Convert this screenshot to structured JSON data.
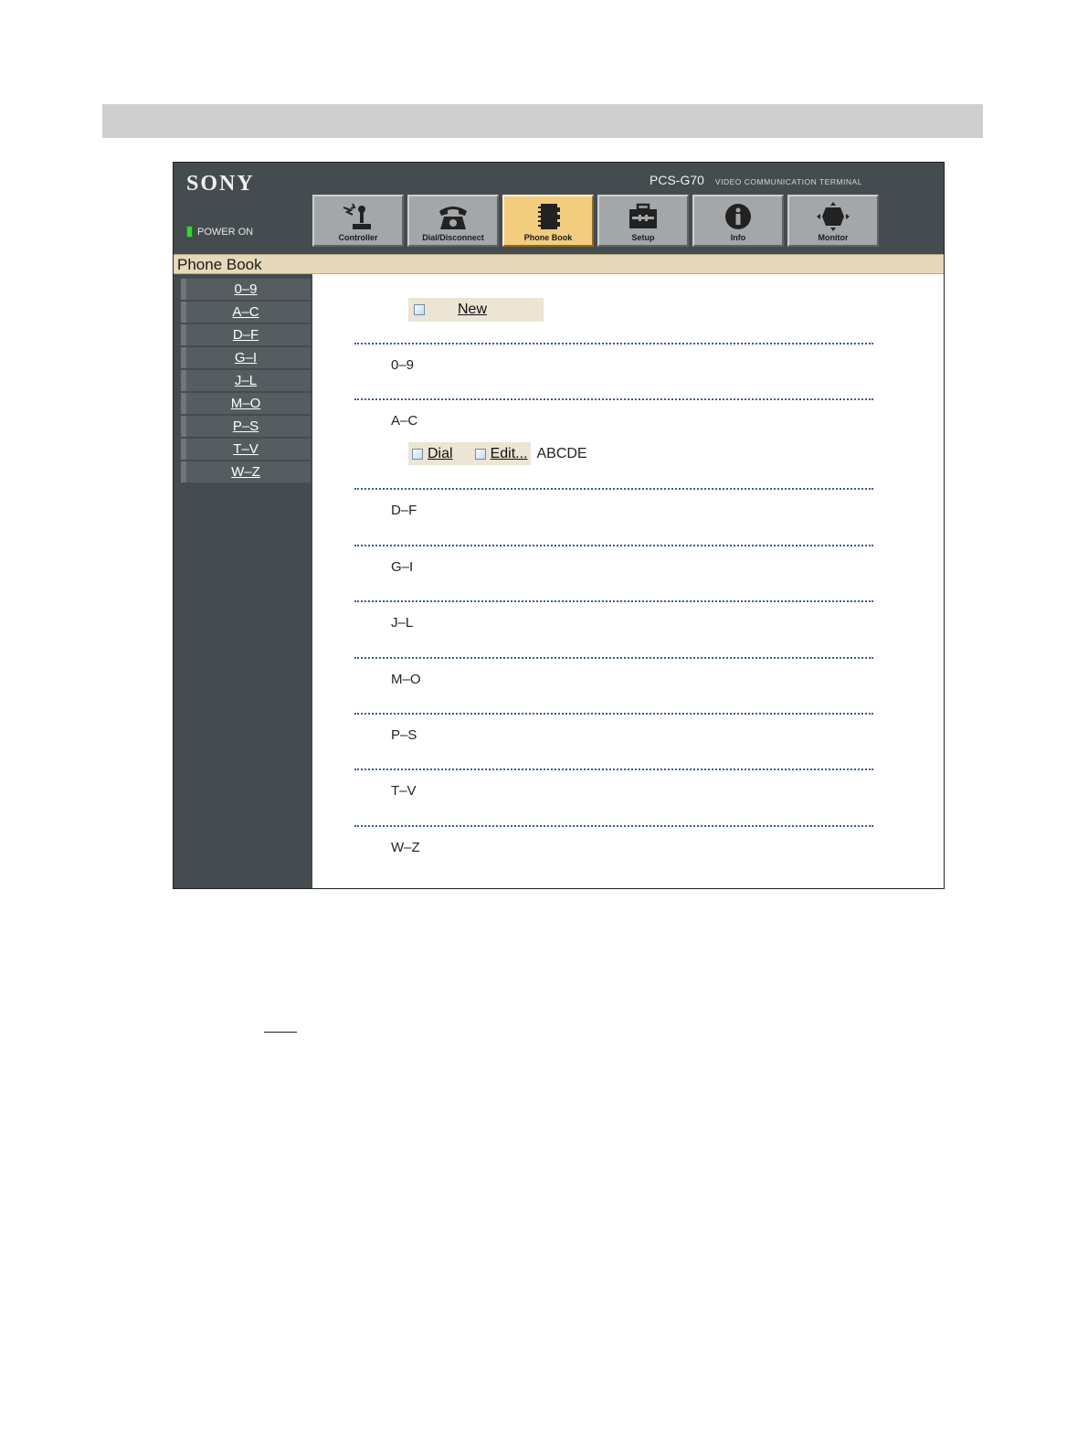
{
  "header": {
    "logo": "SONY",
    "power_label": "POWER ON",
    "model_name": "PCS-G70",
    "model_subtitle": "VIDEO COMMUNICATION TERMINAL",
    "tabs": [
      {
        "label": "Controller",
        "icon": "controller-icon"
      },
      {
        "label": "Dial/Disconnect",
        "icon": "telephone-icon"
      },
      {
        "label": "Phone Book",
        "icon": "phone-book-icon",
        "active": true
      },
      {
        "label": "Setup",
        "icon": "toolbox-icon"
      },
      {
        "label": "Info",
        "icon": "info-icon"
      },
      {
        "label": "Monitor",
        "icon": "monitor-icon"
      }
    ]
  },
  "page": {
    "title": "Phone Book"
  },
  "sidebar": {
    "items": [
      "0–9",
      "A–C",
      "D–F",
      "G–I",
      "J–L",
      "M–O",
      "P–S",
      "T–V",
      "W–Z"
    ]
  },
  "main": {
    "new_label": "New",
    "groups": [
      "0–9",
      "A–C",
      "D–F",
      "G–I",
      "J–L",
      "M–O",
      "P–S",
      "T–V",
      "W–Z"
    ],
    "entry": {
      "dial_label": "Dial",
      "edit_label": "Edit...",
      "name": "ABCDE"
    }
  },
  "colors": {
    "chrome": "#454c4f",
    "active_tab": "#f1cd7d",
    "title_band": "#e6d9b9",
    "divider": "#3a5b9a"
  }
}
